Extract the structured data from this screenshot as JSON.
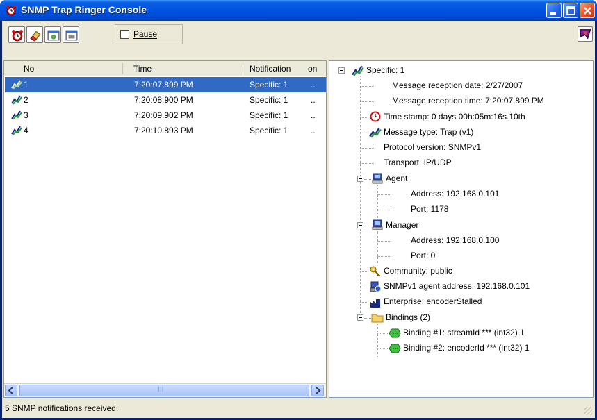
{
  "window": {
    "title": "SNMP Trap Ringer Console",
    "title_icon": "alarm-clock-icon"
  },
  "caption_buttons": [
    "minimize",
    "maximize",
    "close"
  ],
  "toolbar": {
    "buttons": [
      {
        "name": "ringer-button",
        "icon": "alarm-clock-icon"
      },
      {
        "name": "clear-button",
        "icon": "eraser-icon"
      },
      {
        "name": "settings-button",
        "icon": "window-settings-icon"
      },
      {
        "name": "filter-button",
        "icon": "window-filter-icon"
      }
    ],
    "pause_label": "Pause",
    "pause_checked": false,
    "help_icon": "help-icon"
  },
  "list": {
    "columns": [
      "No",
      "Time",
      "Notification",
      "on"
    ],
    "rows": [
      {
        "no": "1",
        "time": "7:20:07.899 PM",
        "notification": "Specific: 1",
        "on": "..",
        "selected": true
      },
      {
        "no": "2",
        "time": "7:20:08.900 PM",
        "notification": "Specific: 1",
        "on": "..",
        "selected": false
      },
      {
        "no": "3",
        "time": "7:20:09.902 PM",
        "notification": "Specific: 1",
        "on": "..",
        "selected": false
      },
      {
        "no": "4",
        "time": "7:20:10.893 PM",
        "notification": "Specific: 1",
        "on": "..",
        "selected": false
      }
    ],
    "scrollbar_grip": "III"
  },
  "tree": {
    "root": "Specific: 1",
    "reception_date": "Message reception date: 2/27/2007",
    "reception_time": "Message reception time: 7:20:07.899 PM",
    "time_stamp": "Time stamp: 0 days 00h:05m:16s.10th",
    "message_type": "Message type: Trap (v1)",
    "protocol_version": "Protocol version: SNMPv1",
    "transport": "Transport: IP/UDP",
    "agent": {
      "label": "Agent",
      "address": "Address: 192.168.0.101",
      "port": "Port: 1178"
    },
    "manager": {
      "label": "Manager",
      "address": "Address: 192.168.0.100",
      "port": "Port: 0"
    },
    "community": "Community: public",
    "agent_address": "SNMPv1 agent address: 192.168.0.101",
    "enterprise": "Enterprise: encoderStalled",
    "bindings": {
      "label": "Bindings (2)",
      "items": [
        "Binding #1: streamId *** (int32) 1",
        "Binding #2: encoderId *** (int32) 1"
      ]
    }
  },
  "status": {
    "text": "5 SNMP notifications received."
  }
}
